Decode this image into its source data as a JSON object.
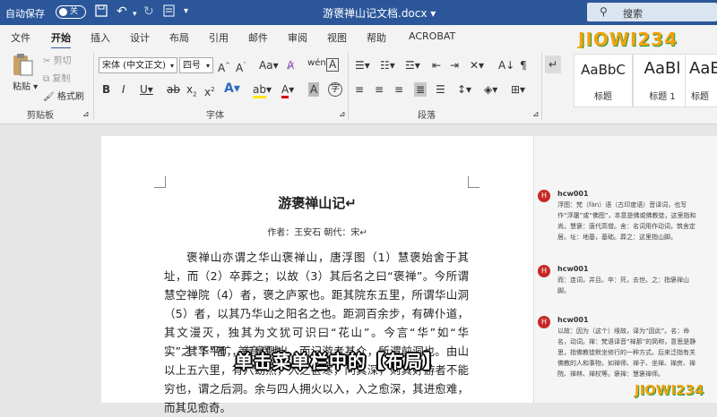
{
  "titlebar": {
    "autosave_label": "自动保存",
    "autosave_state": "关",
    "doc_title": "游褒禅山记文档.docx",
    "search_placeholder": "搜索"
  },
  "tabs": [
    "文件",
    "开始",
    "插入",
    "设计",
    "布局",
    "引用",
    "邮件",
    "审阅",
    "视图",
    "帮助",
    "ACROBAT"
  ],
  "active_tab": "开始",
  "watermark": "JIOWI234",
  "clipboard": {
    "paste": "粘贴",
    "cut": "剪切",
    "copy": "复制",
    "format_painter": "格式刷",
    "group": "剪贴板"
  },
  "font": {
    "name": "宋体 (中文正文)",
    "size": "四号",
    "group": "字体"
  },
  "paragraph": {
    "group": "段落"
  },
  "styles": [
    {
      "preview": "AaBbC",
      "name": "标题"
    },
    {
      "preview": "AaBl",
      "name": "标题 1"
    },
    {
      "preview": "AaBl",
      "name": "标题"
    }
  ],
  "document": {
    "title": "游褒禅山记",
    "author_line": "作者：王安石   朝代：宋",
    "para1": "褒禅山亦谓之华山褒禅山，唐浮图（1）慧褒始舍于其址，而（2）卒葬之；以故（3）其后名之曰“褒禅”。今所谓慧空禅院（4）者，褒之庐冢也。距其院东五里，所谓华山洞（5）者，以其乃华山之阳名之也。距洞百余步，有碑仆道，其文漫灭，独其为文犹可识曰“花山”。今言“华”如“华实”之“华”者，盖音谬也。",
    "para2": "其下平旷，有泉侧出，而记游者甚众，所谓前洞也。由山以上五六里，有穴窈然，入之甚寒，问其深，则其好游者不能穷也，谓之后洞。余与四人拥火以入，入之愈深，其进愈难，而其见愈奇。"
  },
  "comments": [
    {
      "initial": "H",
      "author": "hcw001",
      "text": "浮图：梵（fàn）语（古印度语）音译词，也写作“浮屠”或“佛图”，本意是佛或佛教徒，这里指和尚。慧褒：唐代高僧。舍：名词用作动词，筑舍定居。址：地基，基础。葬之：这里指山脚。"
    },
    {
      "initial": "H",
      "author": "hcw001",
      "text": "而：连词，并且。卒：死，去世。之：指褒禅山脚。"
    },
    {
      "initial": "H",
      "author": "hcw001",
      "text": "以故：因为（这个）缘故，译为“因此”。名：命名，动词。禅：梵语译音“禅那”的简称，意思是静思，指佛教徒默坐修行的一种方式。后来泛指有关佛教的人和事物，如禅师、禅子、坐禅、禅房、禅院、禅林、禅杖等。褒禅：慧褒禅师。"
    }
  ],
  "caption": "单击菜单栏中的【布局】",
  "logo_bottom": "JIOWI234"
}
